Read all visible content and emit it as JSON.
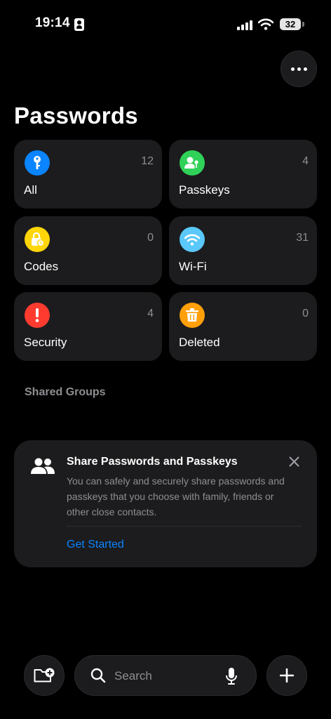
{
  "status": {
    "time": "19:14",
    "battery": "32"
  },
  "title": "Passwords",
  "tiles": [
    {
      "label": "All",
      "count": "12",
      "color": "#0a84ff",
      "icon": "key-icon"
    },
    {
      "label": "Passkeys",
      "count": "4",
      "color": "#30d158",
      "icon": "person-key-icon"
    },
    {
      "label": "Codes",
      "count": "0",
      "color": "#ffd60a",
      "icon": "lock-clock-icon"
    },
    {
      "label": "Wi-Fi",
      "count": "31",
      "color": "#5ac8fa",
      "icon": "wifi-icon"
    },
    {
      "label": "Security",
      "count": "4",
      "color": "#ff3b30",
      "icon": "exclamation-icon"
    },
    {
      "label": "Deleted",
      "count": "0",
      "color": "#ff9f0a",
      "icon": "trash-icon"
    }
  ],
  "shared_groups": {
    "heading": "Shared Groups"
  },
  "share_card": {
    "title": "Share Passwords and Passkeys",
    "description": "You can safely and securely share passwords and passkeys that you choose with family, friends or other close contacts.",
    "action": "Get Started",
    "icon": "people-icon",
    "accent": "#0a84ff"
  },
  "bottom_bar": {
    "search_placeholder": "Search"
  }
}
